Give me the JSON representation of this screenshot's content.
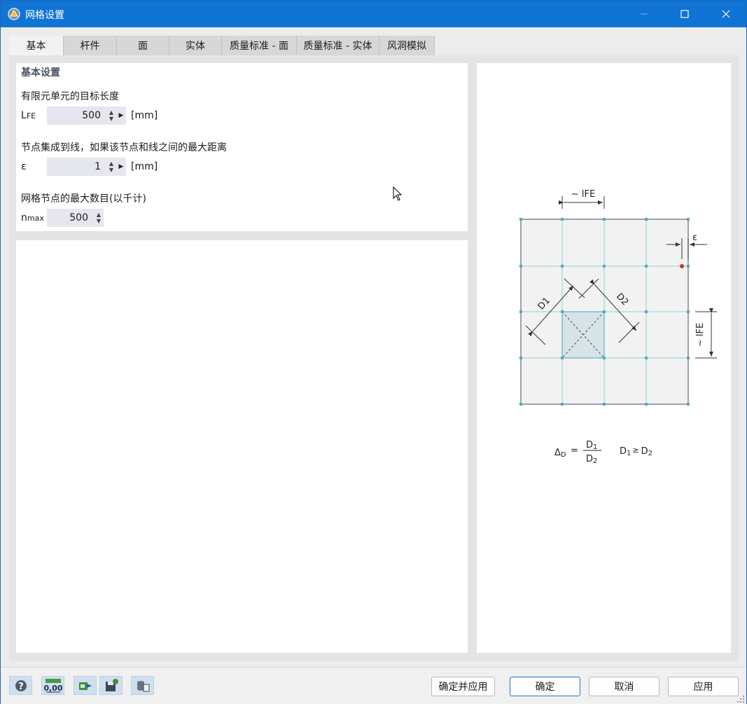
{
  "window": {
    "title": "网格设置"
  },
  "tabs": [
    {
      "label": "基本",
      "active": true
    },
    {
      "label": "杆件",
      "active": false
    },
    {
      "label": "面",
      "active": false
    },
    {
      "label": "实体",
      "active": false
    },
    {
      "label": "质量标准 - 面",
      "active": false
    },
    {
      "label": "质量标准 - 实体",
      "active": false
    },
    {
      "label": "风洞模拟",
      "active": false
    }
  ],
  "basic": {
    "section_title": "基本设置",
    "target_length": {
      "label": "有限元单元的目标长度",
      "symbol_main": "L",
      "symbol_sub": "FE",
      "value": "500",
      "unit": "[mm]"
    },
    "integrate_nodes": {
      "label": "节点集成到线，如果该节点和线之间的最大距离",
      "symbol_main": "ε",
      "value": "1",
      "unit": "[mm]"
    },
    "max_nodes": {
      "label": "网格节点的最大数目(以千计)",
      "symbol_main": "n",
      "symbol_sub": "max",
      "value": "500"
    }
  },
  "diagram": {
    "lfe_top": "~ lFE",
    "lfe_right": "~ lFE",
    "epsilon": "ε",
    "d1": "D1",
    "d2": "D2",
    "formula_lhs": "Δ",
    "formula_lhs_sub": "D",
    "formula_eq": "=",
    "formula_num": "D",
    "formula_num_sub": "1",
    "formula_den": "D",
    "formula_den_sub": "2",
    "condition_a": "D",
    "condition_a_sub": "1",
    "condition_op": "≥",
    "condition_b": "D",
    "condition_b_sub": "2"
  },
  "footer": {
    "tools": [
      "help-icon",
      "decimal-places-icon",
      "export-icon",
      "save-defaults-icon",
      "load-defaults-icon"
    ],
    "decimal_label": "0,00",
    "buttons": {
      "ok_apply": "确定并应用",
      "ok": "确定",
      "cancel": "取消",
      "apply": "应用"
    }
  },
  "colors": {
    "titlebar": "#0f74d4",
    "mesh_line": "#7fd0de",
    "mesh_node": "#5aa9b5",
    "node_highlight": "#c0391b"
  }
}
